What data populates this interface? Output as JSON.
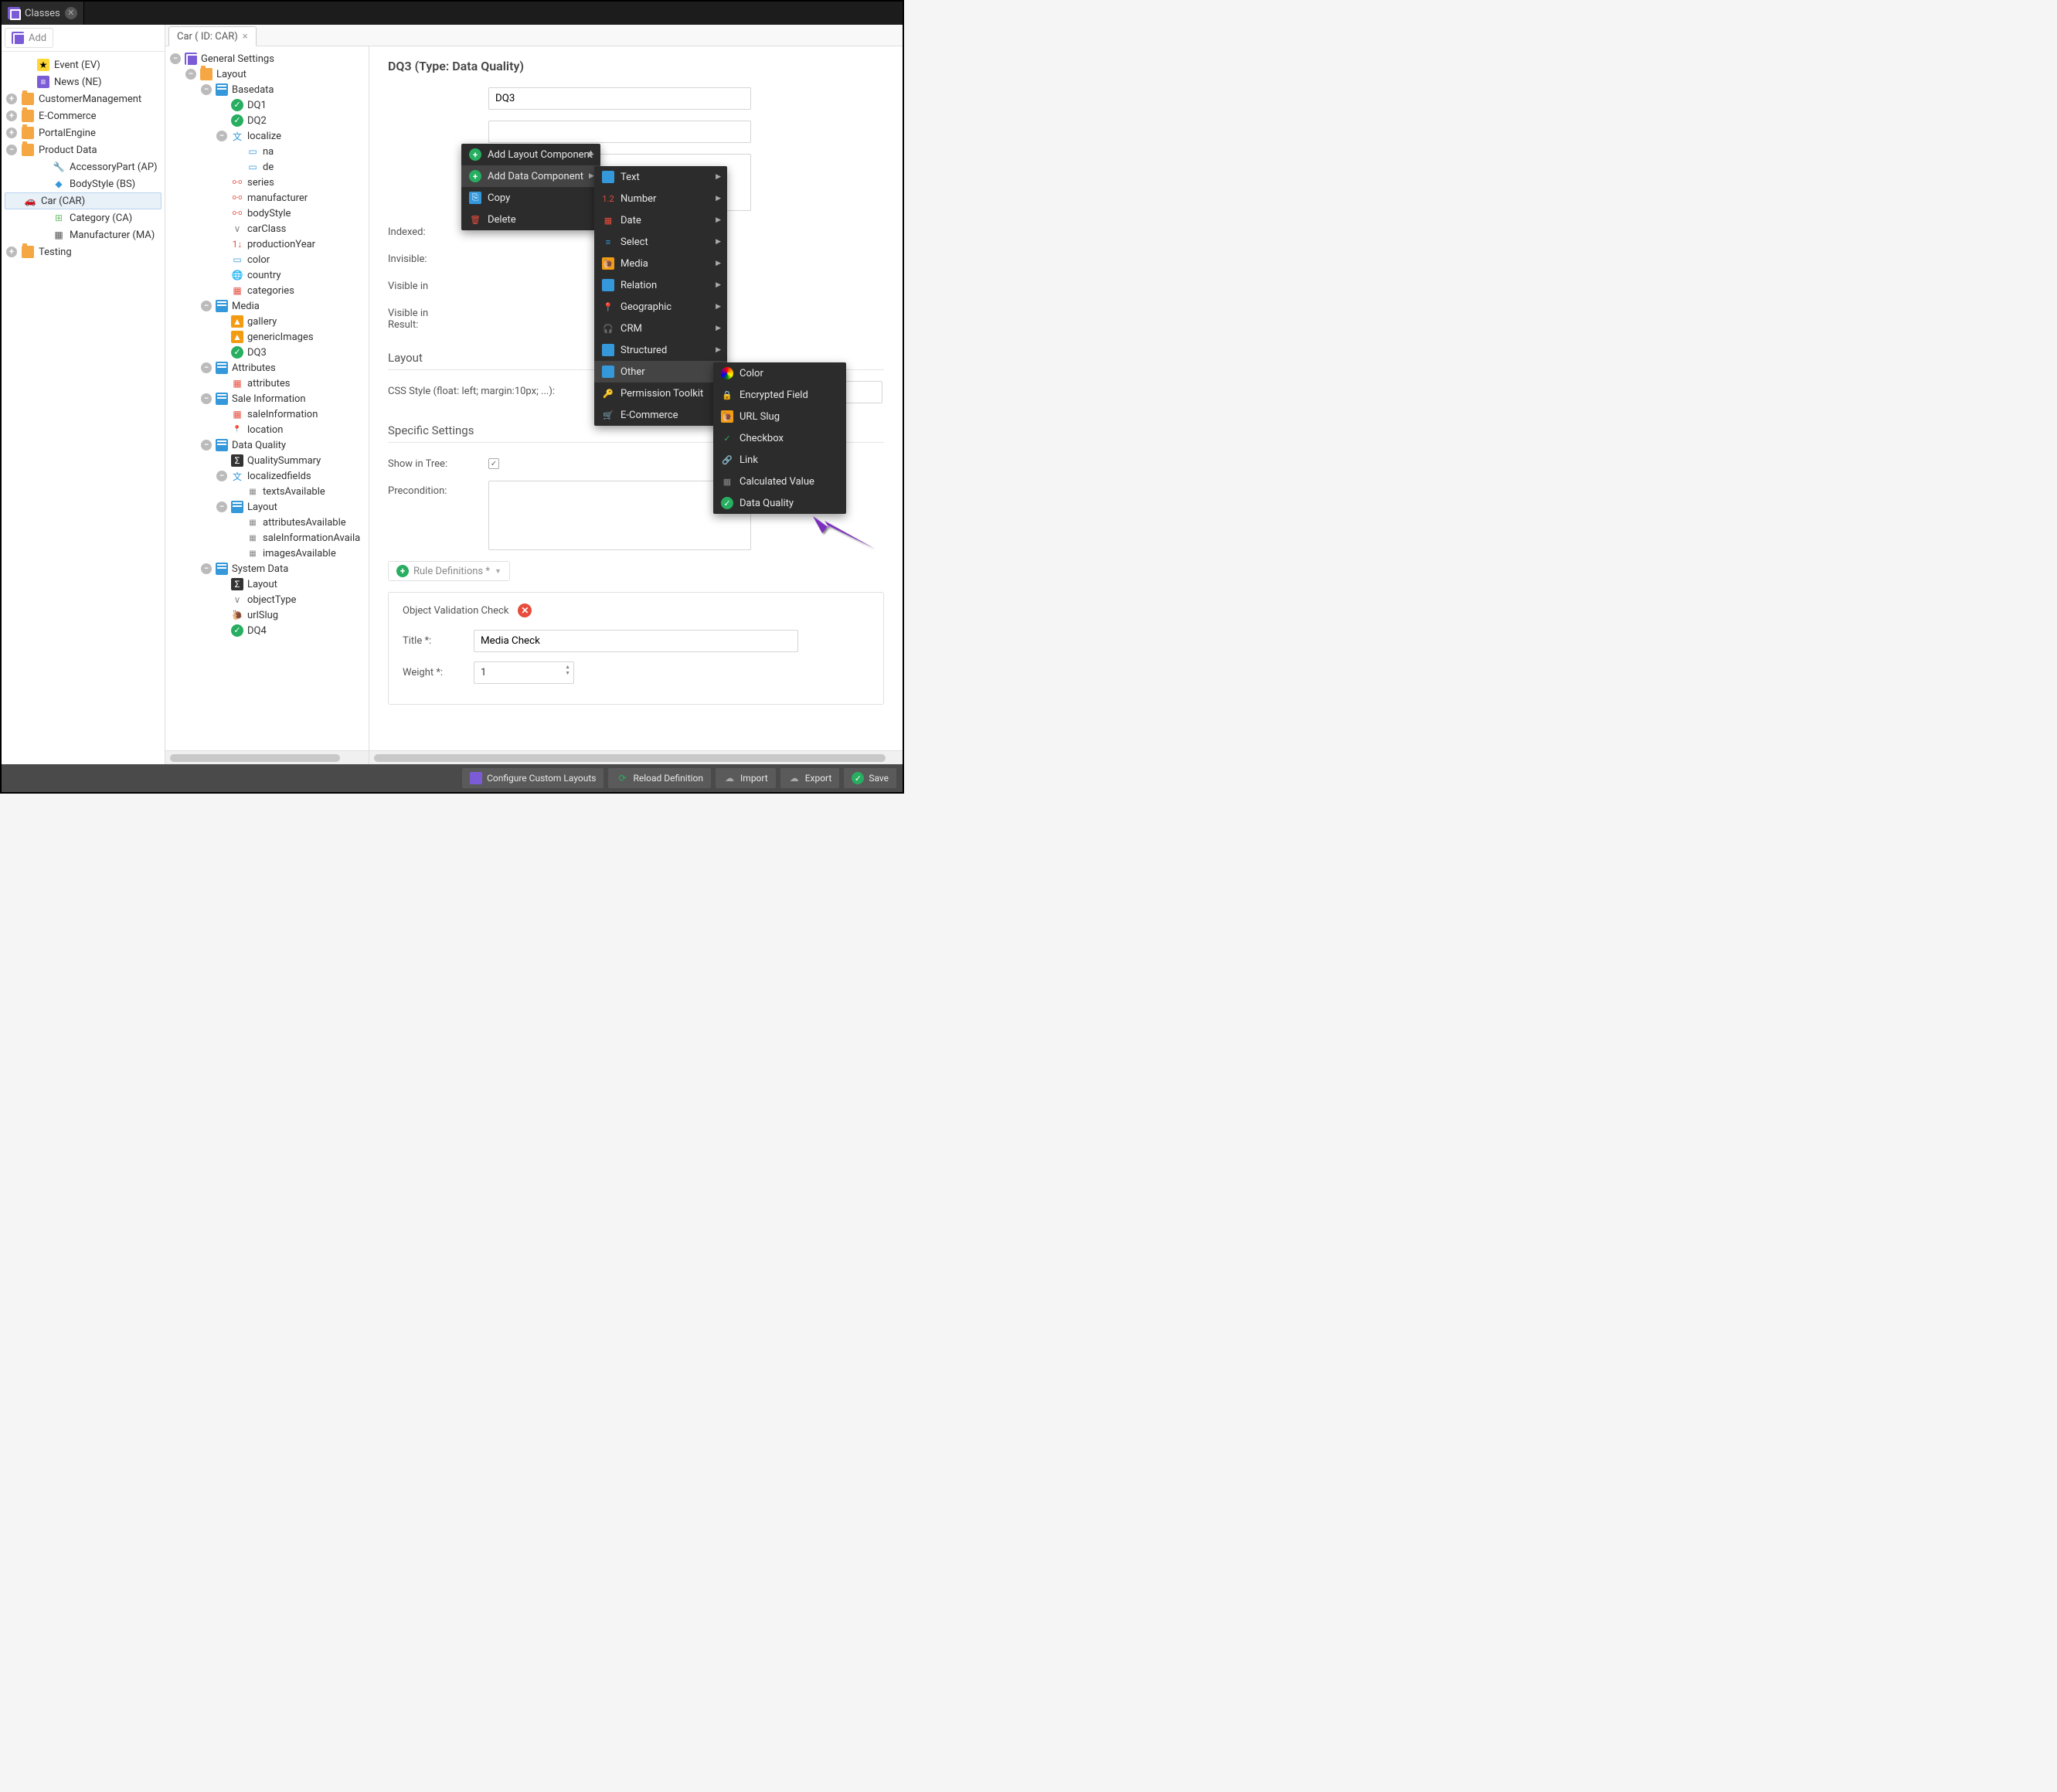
{
  "topTab": {
    "label": "Classes"
  },
  "addBtn": "Add",
  "leftTree": [
    {
      "depth": 1,
      "icon": "star",
      "label": "Event (EV)"
    },
    {
      "depth": 1,
      "icon": "news",
      "label": "News (NE)"
    },
    {
      "depth": 0,
      "icon": "folder",
      "label": "CustomerManagement",
      "expand": "+"
    },
    {
      "depth": 0,
      "icon": "folder",
      "label": "E-Commerce",
      "expand": "+"
    },
    {
      "depth": 0,
      "icon": "folder",
      "label": "PortalEngine",
      "expand": "+"
    },
    {
      "depth": 0,
      "icon": "folder",
      "label": "Product Data",
      "expand": "-"
    },
    {
      "depth": 2,
      "icon": "wrench",
      "label": "AccessoryPart (AP)"
    },
    {
      "depth": 2,
      "icon": "diamond",
      "label": "BodyStyle (BS)"
    },
    {
      "depth": 2,
      "icon": "car",
      "label": "Car (CAR)",
      "sel": true
    },
    {
      "depth": 2,
      "icon": "cat",
      "label": "Category (CA)"
    },
    {
      "depth": 2,
      "icon": "manu",
      "label": "Manufacturer (MA)"
    },
    {
      "depth": 0,
      "icon": "folder",
      "label": "Testing",
      "expand": "+"
    }
  ],
  "mainTab": "Car ( ID: CAR)",
  "structure": [
    {
      "d": 0,
      "icon": "class",
      "label": "General Settings",
      "exp": "-"
    },
    {
      "d": 1,
      "icon": "folder",
      "label": "Layout",
      "exp": "-"
    },
    {
      "d": 2,
      "icon": "panel",
      "label": "Basedata",
      "exp": "-"
    },
    {
      "d": 3,
      "icon": "dq",
      "label": "DQ1"
    },
    {
      "d": 3,
      "icon": "dq",
      "label": "DQ2"
    },
    {
      "d": 3,
      "icon": "localize",
      "label": "localize",
      "exp": "-"
    },
    {
      "d": 4,
      "icon": "field",
      "label": "na"
    },
    {
      "d": 4,
      "icon": "field",
      "label": "de"
    },
    {
      "d": 3,
      "icon": "relation",
      "label": "series"
    },
    {
      "d": 3,
      "icon": "relation",
      "label": "manufacturer"
    },
    {
      "d": 3,
      "icon": "relation",
      "label": "bodyStyle"
    },
    {
      "d": 3,
      "icon": "select",
      "label": "carClass"
    },
    {
      "d": 3,
      "icon": "num",
      "label": "productionYear"
    },
    {
      "d": 3,
      "icon": "field",
      "label": "color"
    },
    {
      "d": 3,
      "icon": "globe",
      "label": "country"
    },
    {
      "d": 3,
      "icon": "grid",
      "label": "categories"
    },
    {
      "d": 2,
      "icon": "panel",
      "label": "Media",
      "exp": "-"
    },
    {
      "d": 3,
      "icon": "img",
      "label": "gallery"
    },
    {
      "d": 3,
      "icon": "img",
      "label": "genericImages"
    },
    {
      "d": 3,
      "icon": "dq",
      "label": "DQ3"
    },
    {
      "d": 2,
      "icon": "panel",
      "label": "Attributes",
      "exp": "-"
    },
    {
      "d": 3,
      "icon": "grid",
      "label": "attributes"
    },
    {
      "d": 2,
      "icon": "panel",
      "label": "Sale Information",
      "exp": "-"
    },
    {
      "d": 3,
      "icon": "grid",
      "label": "saleInformation"
    },
    {
      "d": 3,
      "icon": "red-pin",
      "label": "location"
    },
    {
      "d": 2,
      "icon": "panel",
      "label": "Data Quality",
      "exp": "-"
    },
    {
      "d": 3,
      "icon": "sum",
      "label": "QualitySummary"
    },
    {
      "d": 3,
      "icon": "localize",
      "label": "localizedfields",
      "exp": "-"
    },
    {
      "d": 4,
      "icon": "attr",
      "label": "textsAvailable"
    },
    {
      "d": 3,
      "icon": "panel",
      "label": "Layout",
      "exp": "-"
    },
    {
      "d": 4,
      "icon": "attr",
      "label": "attributesAvailable"
    },
    {
      "d": 4,
      "icon": "attr",
      "label": "saleInformationAvaila"
    },
    {
      "d": 4,
      "icon": "attr",
      "label": "imagesAvailable"
    },
    {
      "d": 2,
      "icon": "panel",
      "label": "System Data",
      "exp": "-"
    },
    {
      "d": 3,
      "icon": "sum",
      "label": "Layout"
    },
    {
      "d": 3,
      "icon": "select",
      "label": "objectType"
    },
    {
      "d": 3,
      "icon": "slug",
      "label": "urlSlug"
    },
    {
      "d": 3,
      "icon": "dq",
      "label": "DQ4"
    }
  ],
  "detail": {
    "header": "DQ3 (Type: Data Quality)",
    "fields": {
      "name": {
        "label": "",
        "value": "DQ3"
      },
      "title": {
        "label": "",
        "value": ""
      },
      "tooltip": {
        "label": "",
        "value": ""
      },
      "indexed": "Indexed:",
      "invisible": "Invisible:",
      "visibleIn": "Visible in",
      "visibleResult": "Visible in\nResult:"
    },
    "layoutHdr": "Layout",
    "cssLabel": "CSS Style (float: left; margin:10px; ...):",
    "specificHdr": "Specific Settings",
    "showInTree": "Show in Tree:",
    "precondition": "Precondition:",
    "ruleDefs": "Rule Definitions *",
    "ruleBox": {
      "hdr": "Object Validation Check",
      "titleLabel": "Title *:",
      "titleValue": "Media Check",
      "weightLabel": "Weight *:",
      "weightValue": "1"
    }
  },
  "ctxMenu1": [
    {
      "icon": "green-plus",
      "label": "Add Layout Component",
      "sub": true
    },
    {
      "icon": "green-plus",
      "label": "Add Data Component",
      "sub": true,
      "hover": true
    },
    {
      "icon": "copy",
      "label": "Copy"
    },
    {
      "icon": "delete",
      "label": "Delete"
    }
  ],
  "ctxMenu2": [
    {
      "icon": "blue",
      "label": "Text",
      "sub": true
    },
    {
      "icon": "num",
      "label": "Number",
      "sub": true
    },
    {
      "icon": "calendar",
      "label": "Date",
      "sub": true
    },
    {
      "icon": "list",
      "label": "Select",
      "sub": true
    },
    {
      "icon": "orange",
      "label": "Media",
      "sub": true
    },
    {
      "icon": "blue",
      "label": "Relation",
      "sub": true
    },
    {
      "icon": "red-pin",
      "label": "Geographic",
      "sub": true
    },
    {
      "icon": "headset",
      "label": "CRM",
      "sub": true
    },
    {
      "icon": "grid-blue",
      "label": "Structured",
      "sub": true
    },
    {
      "icon": "blue",
      "label": "Other",
      "sub": true,
      "hover": true
    },
    {
      "icon": "yellow-key",
      "label": "Permission Toolkit",
      "sub": true
    },
    {
      "icon": "cart",
      "label": "E-Commerce",
      "sub": true
    }
  ],
  "ctxMenu3": [
    {
      "icon": "color-wheel",
      "label": "Color"
    },
    {
      "icon": "lock",
      "label": "Encrypted Field"
    },
    {
      "icon": "orange",
      "label": "URL Slug"
    },
    {
      "icon": "check",
      "label": "Checkbox"
    },
    {
      "icon": "link",
      "label": "Link"
    },
    {
      "icon": "calc",
      "label": "Calculated Value"
    },
    {
      "icon": "dq-circle",
      "label": "Data Quality"
    }
  ],
  "footer": [
    {
      "icon": "purple",
      "label": "Configure Custom Layouts"
    },
    {
      "icon": "reload",
      "label": "Reload Definition"
    },
    {
      "icon": "cloud",
      "label": "Import"
    },
    {
      "icon": "cloud",
      "label": "Export"
    },
    {
      "icon": "check",
      "label": "Save"
    }
  ]
}
